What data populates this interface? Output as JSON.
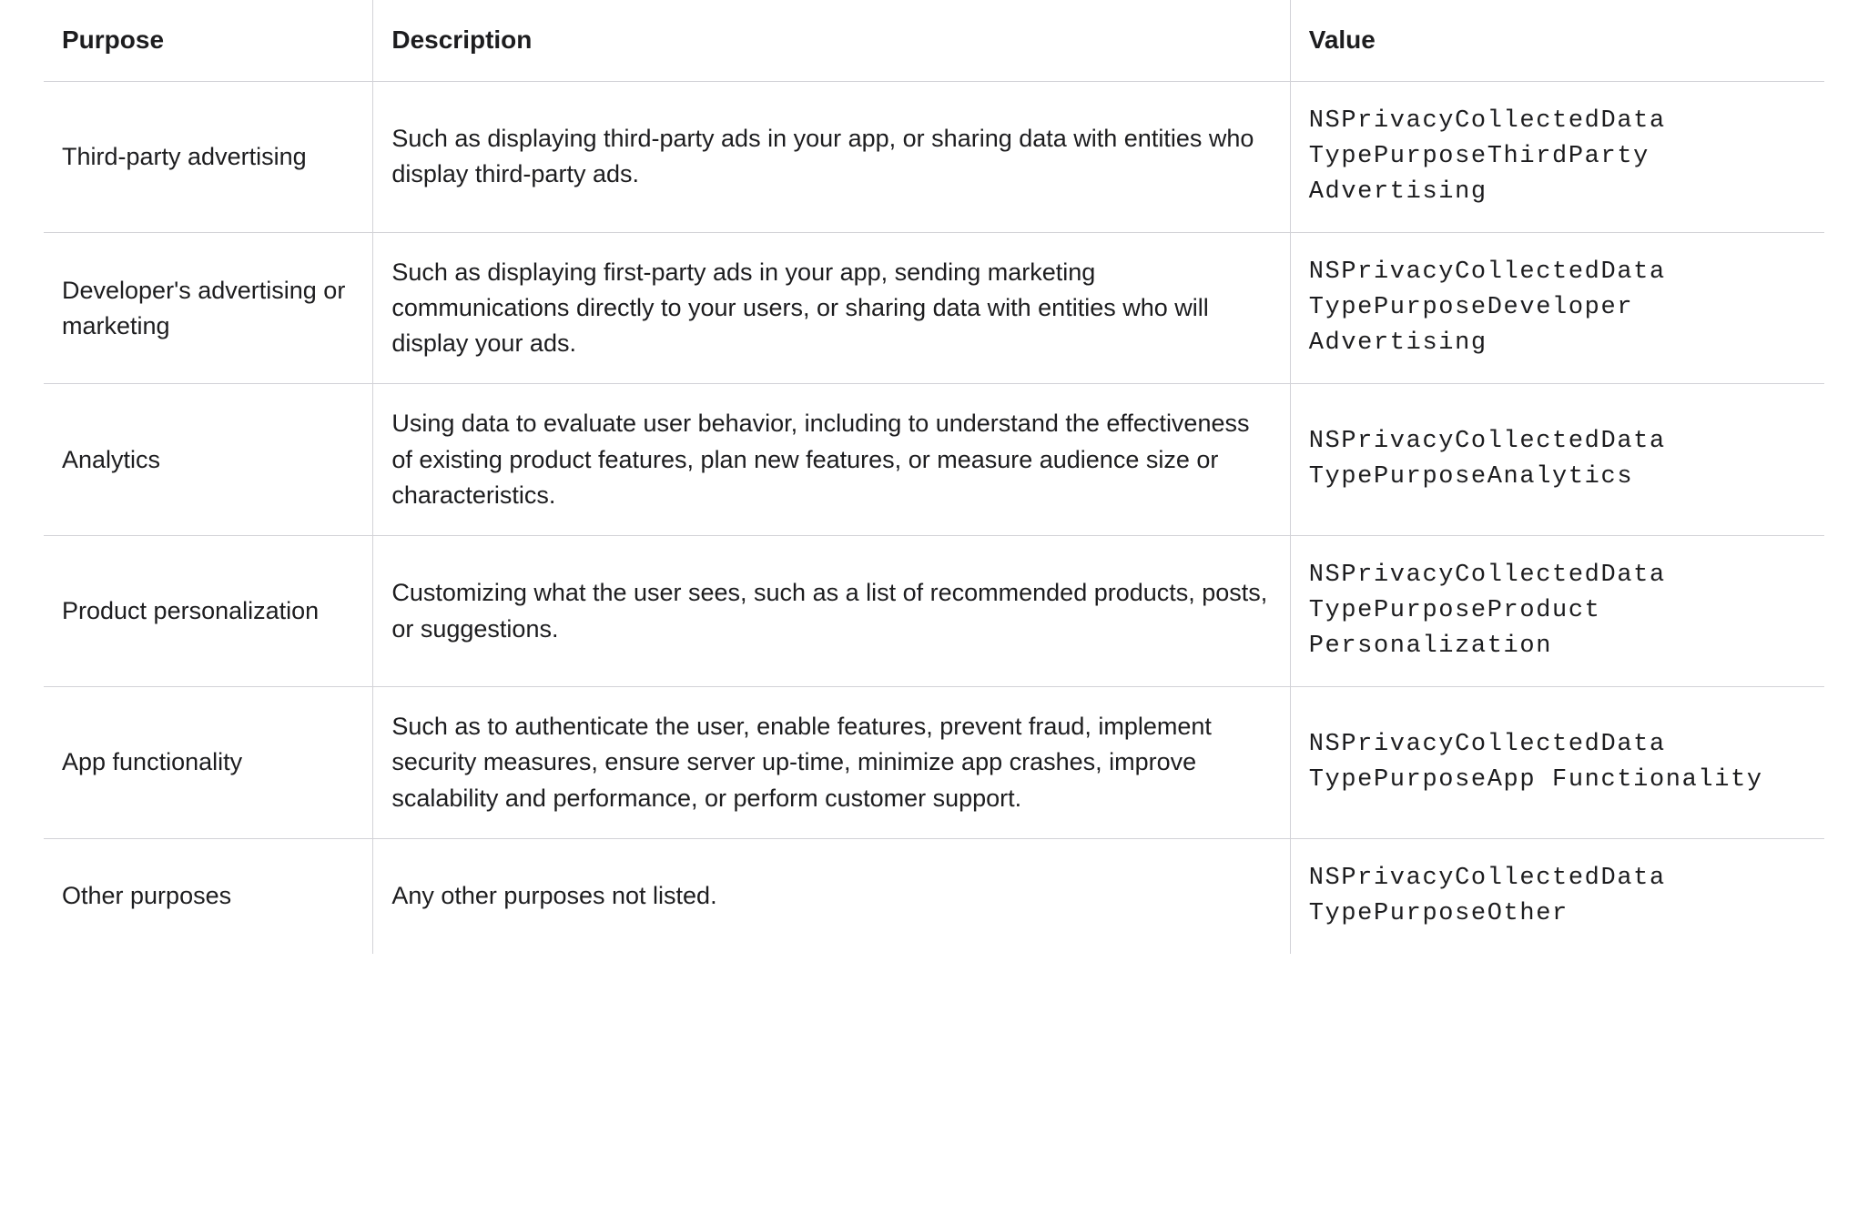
{
  "table": {
    "headers": {
      "purpose": "Purpose",
      "description": "Description",
      "value": "Value"
    },
    "rows": [
      {
        "purpose": "Third-party advertising",
        "description": "Such as displaying third-party ads in your app, or sharing data with entities who display third-party ads.",
        "value": "NSPrivacyCollectedData TypePurposeThirdParty Advertising"
      },
      {
        "purpose": "Developer's advertising or marketing",
        "description": "Such as displaying first-party ads in your app, sending marketing communications directly to your users, or sharing data with entities who will display your ads.",
        "value": "NSPrivacyCollectedData TypePurposeDeveloper Advertising"
      },
      {
        "purpose": "Analytics",
        "description": "Using data to evaluate user behavior, including to understand the effectiveness of existing product features, plan new features, or measure audience size or characteristics.",
        "value": "NSPrivacyCollectedData TypePurposeAnalytics"
      },
      {
        "purpose": "Product personalization",
        "description": "Customizing what the user sees, such as a list of recommended products, posts, or suggestions.",
        "value": "NSPrivacyCollectedData TypePurposeProduct Personalization"
      },
      {
        "purpose": "App functionality",
        "description": "Such as to authenticate the user, enable features, prevent fraud, implement security measures, ensure server up-time, minimize app crashes, improve scalability and performance, or perform customer support.",
        "value": "NSPrivacyCollectedData TypePurposeApp Functionality"
      },
      {
        "purpose": "Other purposes",
        "description": "Any other purposes not listed.",
        "value": "NSPrivacyCollectedData TypePurposeOther"
      }
    ]
  }
}
